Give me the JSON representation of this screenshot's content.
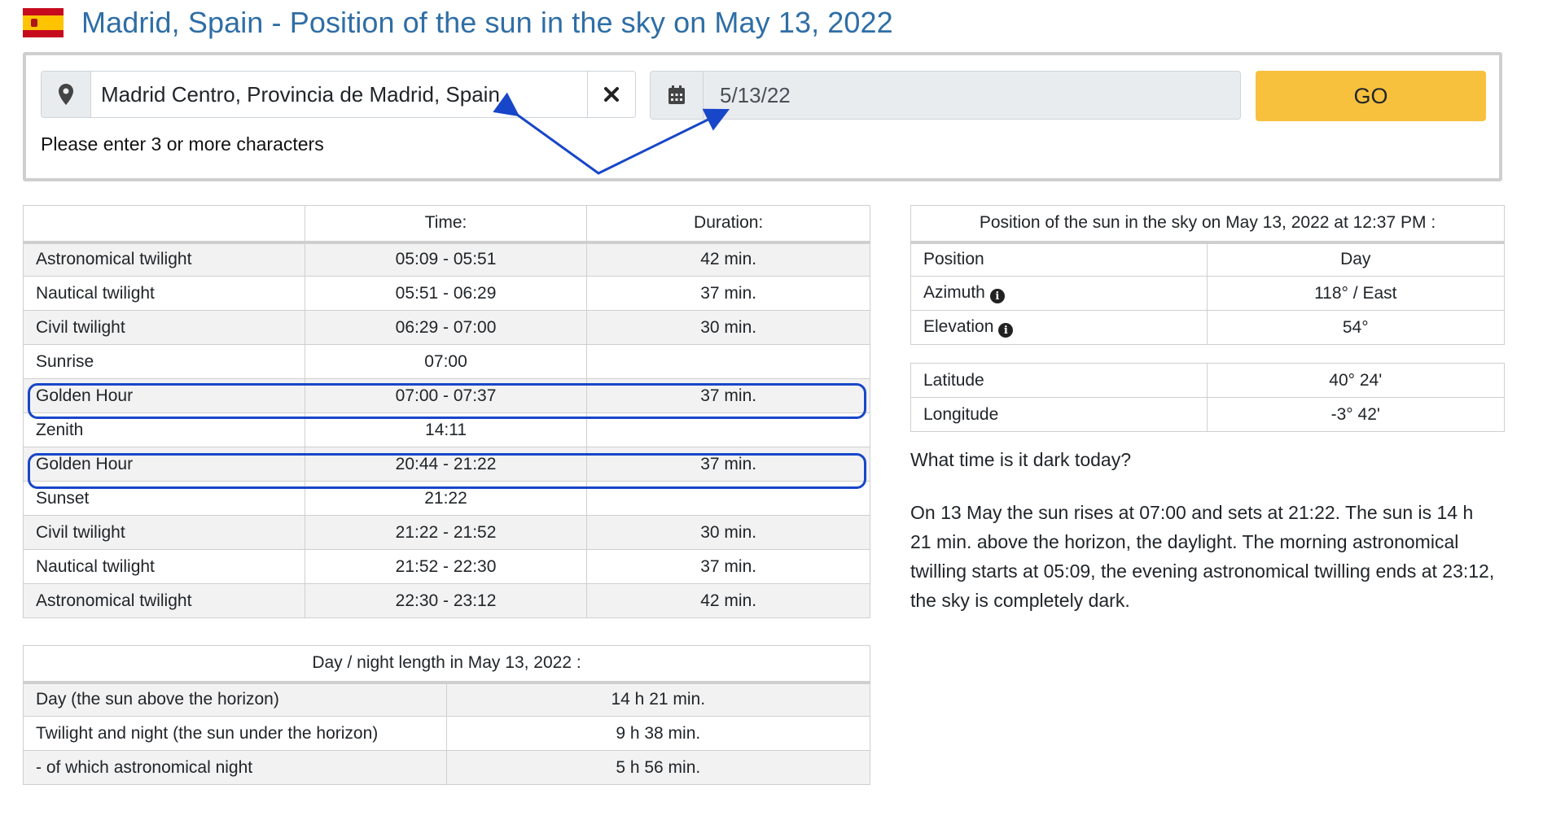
{
  "header": {
    "title": "Madrid, Spain - Position of the sun in the sky on May 13, 2022",
    "flag_icon": "spain-flag"
  },
  "search": {
    "location_icon": "map-marker-icon",
    "location_value": "Madrid Centro, Provincia de Madrid, Spain",
    "clear_icon": "close-icon",
    "calendar_icon": "calendar-icon",
    "date_value": "5/13/22",
    "go_label": "GO",
    "hint": "Please enter 3 or more characters"
  },
  "colors": {
    "title": "#2f6ea5",
    "go_button": "#f7c13e",
    "highlight": "#1746c9"
  },
  "twilight_table": {
    "headers": [
      "",
      "Time:",
      "Duration:"
    ],
    "rows": [
      [
        "Astronomical twilight",
        "05:09 - 05:51",
        "42 min."
      ],
      [
        "Nautical twilight",
        "05:51 - 06:29",
        "37 min."
      ],
      [
        "Civil twilight",
        "06:29 - 07:00",
        "30 min."
      ],
      [
        "Sunrise",
        "07:00",
        ""
      ],
      [
        "Golden Hour",
        "07:00 - 07:37",
        "37 min."
      ],
      [
        "Zenith",
        "14:11",
        ""
      ],
      [
        "Golden Hour",
        "20:44 - 21:22",
        "37 min."
      ],
      [
        "Sunset",
        "21:22",
        ""
      ],
      [
        "Civil twilight",
        "21:22 - 21:52",
        "30 min."
      ],
      [
        "Nautical twilight",
        "21:52 - 22:30",
        "37 min."
      ],
      [
        "Astronomical twilight",
        "22:30 - 23:12",
        "42 min."
      ]
    ]
  },
  "length_table": {
    "header": "Day / night length in May 13, 2022 :",
    "rows": [
      [
        "Day (the sun above the horizon)",
        "14 h 21 min."
      ],
      [
        "Twilight and night (the sun under the horizon)",
        "9 h 38 min."
      ],
      [
        "- of which astronomical night",
        "5 h 56 min."
      ]
    ]
  },
  "position_table": {
    "header": "Position of the sun in the sky on May 13, 2022 at 12:37 PM :",
    "rows": [
      [
        "Position",
        "Day"
      ],
      [
        "Azimuth",
        "118° / East"
      ],
      [
        "Elevation",
        "54°"
      ]
    ]
  },
  "coord_table": {
    "rows": [
      [
        "Latitude",
        "40° 24'"
      ],
      [
        "Longitude",
        "-3° 42'"
      ]
    ]
  },
  "dark": {
    "question": "What time is it dark today?",
    "text": "On 13 May the sun rises at 07:00 and sets at 21:22. The sun is 14 h 21 min. above the horizon, the daylight. The morning astronomical twilling starts at 05:09, the evening astronomical twilling ends at 23:12, the sky is completely dark."
  }
}
